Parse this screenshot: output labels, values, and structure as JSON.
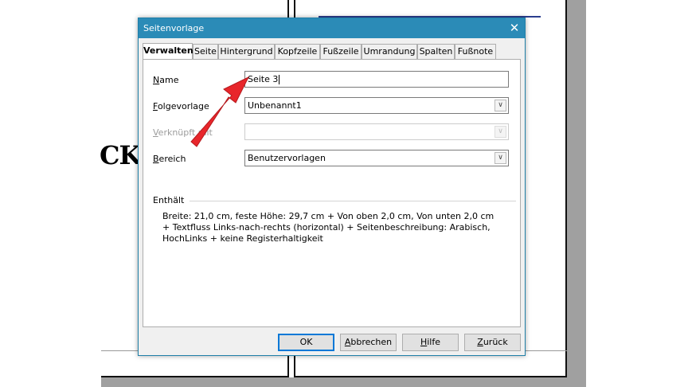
{
  "background": {
    "visible_text": "CK"
  },
  "dialog": {
    "title": "Seitenvorlage",
    "close_glyph": "✕",
    "tabs": [
      {
        "label": "Verwalten",
        "active": true
      },
      {
        "label": "Seite"
      },
      {
        "label": "Hintergrund"
      },
      {
        "label": "Kopfzeile"
      },
      {
        "label": "Fußzeile"
      },
      {
        "label": "Umrandung"
      },
      {
        "label": "Spalten"
      },
      {
        "label": "Fußnote"
      }
    ],
    "fields": {
      "name": {
        "label_accel": "N",
        "label_rest": "ame",
        "value": "Seite 3"
      },
      "next_style": {
        "label_accel": "F",
        "label_rest": "olgevorlage",
        "value": "Unbenannt1"
      },
      "linked_with": {
        "label_accel": "V",
        "label_rest": "erknüpft mit",
        "value": ""
      },
      "category": {
        "label_accel": "B",
        "label_rest": "ereich",
        "value": "Benutzervorlagen"
      }
    },
    "contains": {
      "heading": "Enthält",
      "text": "Breite: 21,0 cm, feste Höhe: 29,7 cm + Von oben 2,0 cm, Von unten 2,0 cm + Textfluss Links-nach-rechts (horizontal) + Seitenbeschreibung: Arabisch, HochLinks + keine Registerhaltigkeit"
    },
    "buttons": {
      "ok": {
        "label": "OK"
      },
      "cancel": {
        "accel": "A",
        "rest": "bbrechen"
      },
      "help": {
        "accel": "H",
        "rest": "ilfe"
      },
      "reset": {
        "accel": "Z",
        "rest": "urück"
      }
    },
    "dropdown_glyph": "∨"
  },
  "colors": {
    "titlebar": "#2b8bb7",
    "annotation_arrow": "#e8262b"
  }
}
